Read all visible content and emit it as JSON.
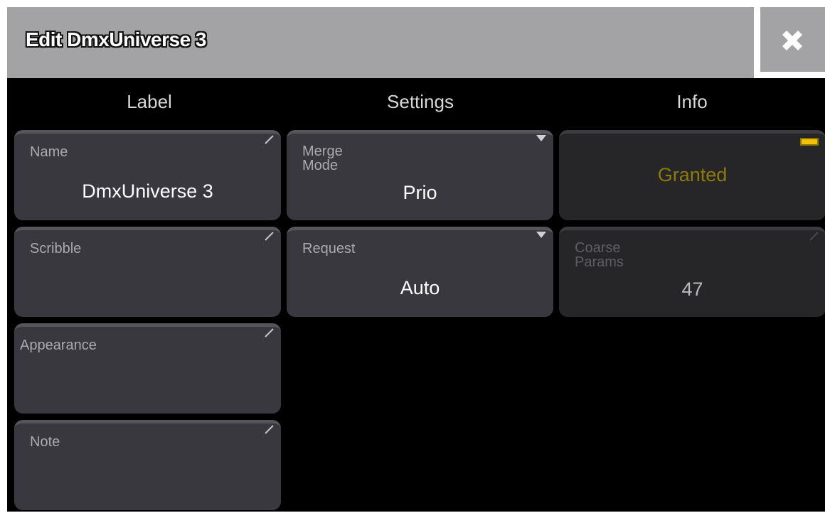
{
  "dialog": {
    "title": "Edit DmxUniverse 3",
    "close_icon": "close-x-icon"
  },
  "columns": {
    "label": "Label",
    "settings": "Settings",
    "info": "Info"
  },
  "label_fields": {
    "name": {
      "label": "Name",
      "value": "DmxUniverse 3"
    },
    "scribble": {
      "label": "Scribble",
      "value": ""
    },
    "appearance": {
      "label": "Appearance",
      "value": ""
    },
    "note": {
      "label": "Note",
      "value": ""
    }
  },
  "settings_fields": {
    "merge_mode": {
      "label_line1": "Merge",
      "label_line2": "Mode",
      "value": "Prio"
    },
    "request": {
      "label": "Request",
      "value": "Auto"
    }
  },
  "info_fields": {
    "status": {
      "value": "Granted",
      "color": "#8d7a08"
    },
    "coarse_params": {
      "label_line1": "Coarse",
      "label_line2": "Params",
      "value": "47"
    }
  },
  "colors": {
    "title_bar": "#a3a3a6",
    "field_bg": "#38383e",
    "field_bg_disabled": "#262629",
    "status_indicator": "#f2c200"
  }
}
